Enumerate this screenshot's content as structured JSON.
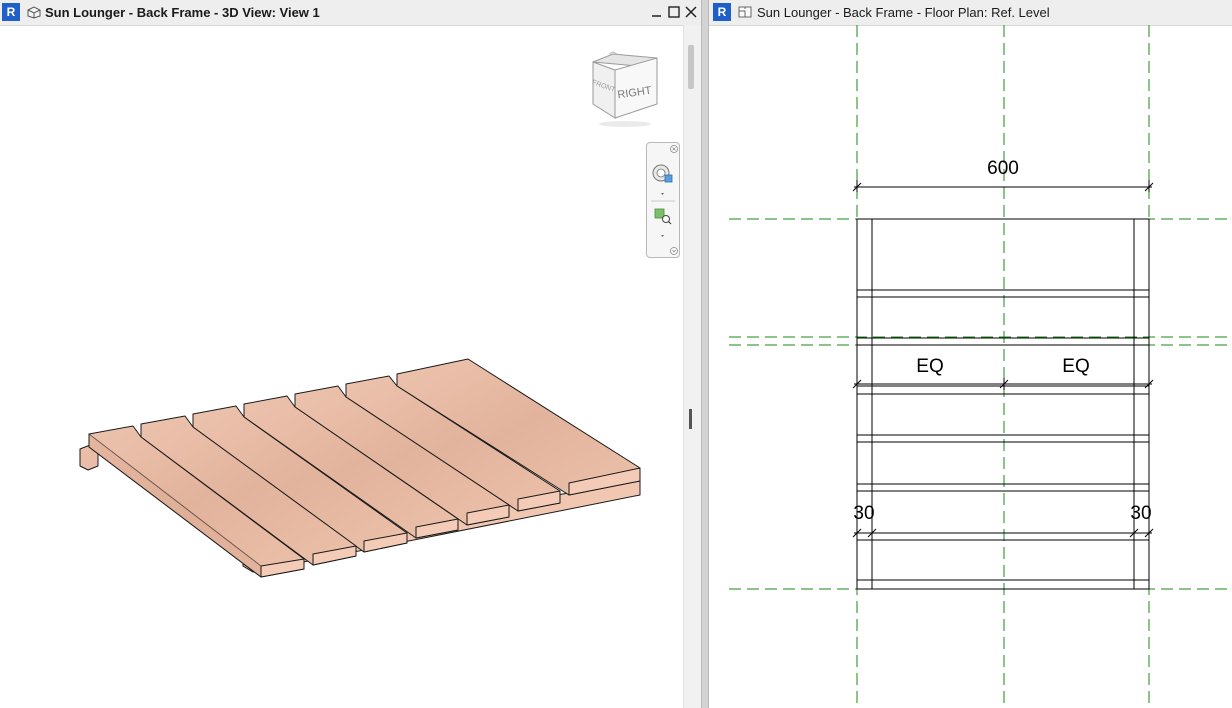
{
  "left_window": {
    "title": "Sun Lounger - Back Frame - 3D View: View 1",
    "view_cube": {
      "face_front": "RIGHT",
      "face_side": "FRONT"
    },
    "logo": "R",
    "icons": {
      "view": "3d-view-icon",
      "minimize": "minimize-icon",
      "maximize": "maximize-icon",
      "close": "close-icon"
    }
  },
  "right_window": {
    "title": "Sun Lounger - Back Frame - Floor Plan: Ref. Level",
    "logo": "R",
    "icons": {
      "view": "floor-plan-icon"
    }
  },
  "floor_plan": {
    "dimensions": {
      "overall_width": "600",
      "equal_left": "EQ",
      "equal_right": "EQ",
      "edge_left": "30",
      "edge_right": "30"
    },
    "colors": {
      "reference_plane": "#1a8a1a",
      "lines": "#000000"
    }
  },
  "model": {
    "colors": {
      "wood_top": "#e6b9a3",
      "wood_side": "#f1c4ad",
      "edge": "#1a1a1a"
    }
  }
}
